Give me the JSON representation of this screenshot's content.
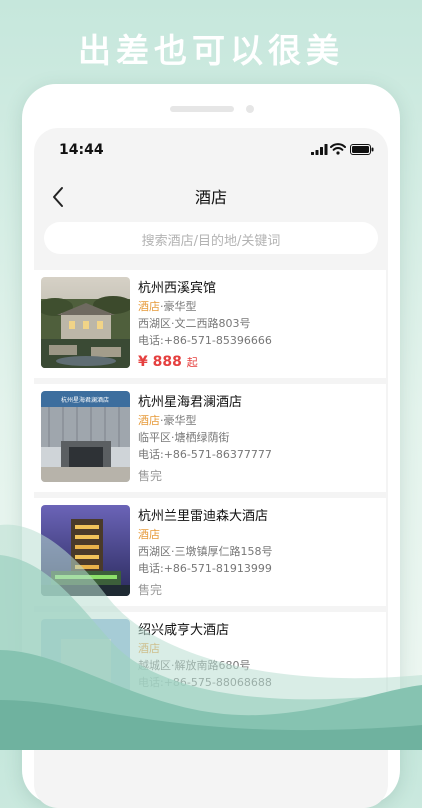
{
  "headline": "出差也可以很美",
  "status_bar": {
    "time": "14:44"
  },
  "nav": {
    "title": "酒店"
  },
  "search": {
    "placeholder": "搜索酒店/目的地/关键词"
  },
  "hotels": [
    {
      "name": "杭州西溪宾馆",
      "type": "酒店",
      "grade": "·豪华型",
      "address": "西湖区·文二西路803号",
      "phone": "电话:+86-571-85396666",
      "price": "¥ 888",
      "price_suffix": "起"
    },
    {
      "name": "杭州星海君澜酒店",
      "type": "酒店",
      "grade": "·豪华型",
      "address": "临平区·塘栖绿荫街",
      "phone": "电话:+86-571-86377777",
      "status": "售完",
      "sign_text": "杭州星海君澜酒店"
    },
    {
      "name": "杭州兰里雷迪森大酒店",
      "type": "酒店",
      "grade": "",
      "address": "西湖区·三墩镇厚仁路158号",
      "phone": "电话:+86-571-81913999",
      "status": "售完"
    },
    {
      "name": "绍兴咸亨大酒店",
      "type": "酒店",
      "grade": "",
      "address": "越城区·解放南路680号",
      "phone": "电话:+86-575-88068688"
    }
  ]
}
